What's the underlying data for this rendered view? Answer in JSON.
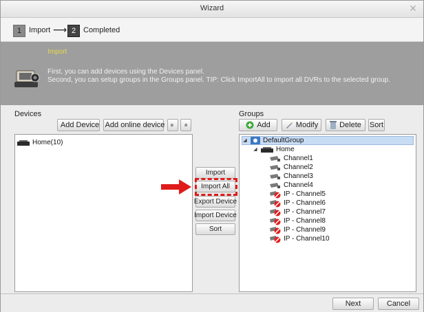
{
  "window": {
    "title": "Wizard"
  },
  "steps": [
    {
      "number": "1",
      "label": "Import",
      "active": false
    },
    {
      "number": "2",
      "label": "Completed",
      "active": true
    }
  ],
  "banner": {
    "heading": "Import",
    "line1": "First, you can add devices using the Devices panel.",
    "line2": "Second, you can setup groups in the Groups panel. TIP: Click ImportAll to import all DVRs to the selected group."
  },
  "devices": {
    "title": "Devices",
    "add_device_label": "Add Device",
    "add_online_device_label": "Add online device",
    "expand_all_label": "»",
    "collapse_all_label": "»",
    "items": [
      "Home(10)"
    ]
  },
  "middle": {
    "import_label": "Import",
    "import_all_label": "Import All",
    "export_device_label": "Export Device",
    "import_device_label": "Import Device",
    "sort_label": "Sort"
  },
  "groups": {
    "title": "Groups",
    "add_label": "Add",
    "modify_label": "Modify",
    "delete_label": "Delete",
    "sort_label": "Sort",
    "root": "DefaultGroup",
    "device": "Home",
    "channels": [
      "Channel1",
      "Channel2",
      "Channel3",
      "Channel4"
    ],
    "ip_channels": [
      "IP - Channel5",
      "IP - Channel6",
      "IP - Channel7",
      "IP - Channel8",
      "IP - Channel9",
      "IP - Channel10"
    ]
  },
  "footer": {
    "next_label": "Next",
    "cancel_label": "Cancel"
  },
  "colors": {
    "banner_heading": "#e6d94a",
    "highlight": "#e01b1b",
    "selection": "#c8dcf4",
    "add_icon": "#3ca83c"
  },
  "icons": [
    "close-icon",
    "banner-devices-icon",
    "add-icon",
    "online-device-icon",
    "expand-all-icon",
    "collapse-all-icon",
    "group-icon",
    "dvr-icon",
    "camera-icon",
    "ip-camera-icon",
    "modify-icon",
    "delete-icon"
  ]
}
